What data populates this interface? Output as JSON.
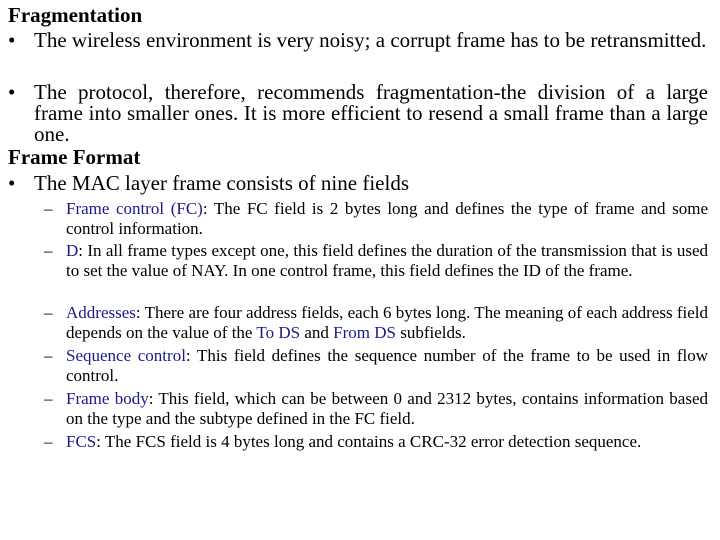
{
  "section1": {
    "heading": "Fragmentation",
    "bullets": [
      {
        "symbol": "•",
        "text": "The wireless environment is very noisy; a corrupt frame has to be retransmitted."
      },
      {
        "symbol": "•",
        "text": "The protocol, therefore, recommends fragmentation-the division of a large frame into smaller ones. It is more efficient to resend a small frame than a large one."
      }
    ]
  },
  "section2": {
    "heading": "Frame Format",
    "bullet": {
      "symbol": "•",
      "text": "The MAC layer frame consists of nine fields"
    },
    "fields": [
      {
        "symbol": "–",
        "term": "Frame control (FC)",
        "text": ": The FC field is 2 bytes long and defines the type of frame and some control information."
      },
      {
        "symbol": "–",
        "term": "D",
        "text": ": In all frame types except one, this field defines the duration of the transmission that is used to set the value of NAY. In one control frame, this field defines the ID of the frame."
      },
      {
        "symbol": "–",
        "term": "Addresses",
        "text_a": ": There are four address fields, each 6 bytes long. The meaning of each address field depends on the value of the ",
        "term_b": "To DS",
        "text_b": " and ",
        "term_c": "From DS",
        "text_c": " subfields."
      },
      {
        "symbol": "–",
        "term": "Sequence control",
        "text": ": This field defines the sequence number of the frame to be used in flow control."
      },
      {
        "symbol": "–",
        "term": "Frame body",
        "text": ": This field, which can be between 0 and 2312 bytes, contains information based on the type and the subtype defined in the FC field."
      },
      {
        "symbol": "–",
        "term": "FCS",
        "text": ": The FCS field is 4 bytes long and contains a CRC-32 error detection sequence."
      }
    ]
  },
  "colors": {
    "term": "#1a1a8c",
    "text": "#000000",
    "background": "#ffffff"
  }
}
